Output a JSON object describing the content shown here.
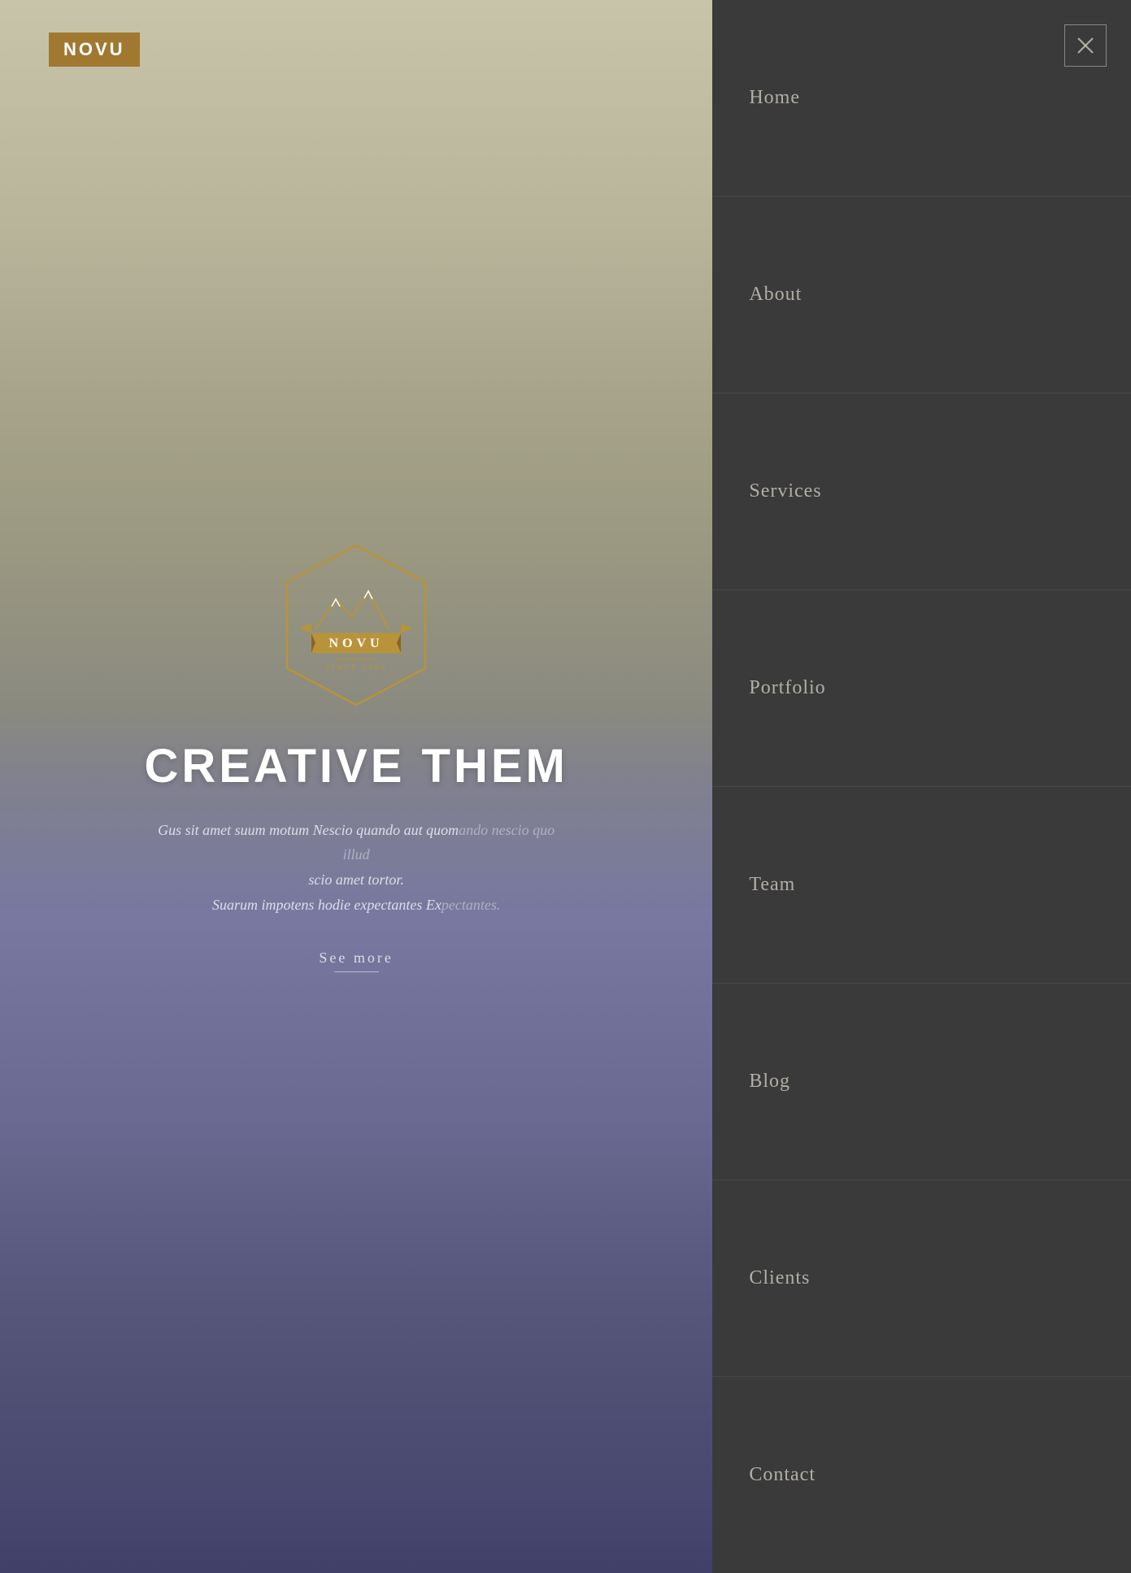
{
  "logo": {
    "text": "NOVU"
  },
  "badge": {
    "brand": "NOVU",
    "tagline": "SINCE 2009"
  },
  "hero": {
    "title": "CREATIVE THE",
    "subtitle_line1": "Gus sit amet suum motum Nescio quando aut quom",
    "subtitle_line1_faded": "ando nescio quo illud",
    "subtitle_line2": "scio amet tortor.",
    "subtitle_line3": "Suarum impotens hodie expectantes Ex",
    "subtitle_line3_faded": "pectantes.",
    "see_more": "See more"
  },
  "nav": {
    "close_label": "×",
    "items": [
      {
        "label": "Home"
      },
      {
        "label": "About"
      },
      {
        "label": "Services"
      },
      {
        "label": "Portfolio"
      },
      {
        "label": "Team"
      },
      {
        "label": "Blog"
      },
      {
        "label": "Clients"
      },
      {
        "label": "Contact"
      }
    ]
  },
  "colors": {
    "accent_gold": "#a07830",
    "nav_bg": "#3a3a3a",
    "nav_text": "rgba(200,195,185,0.85)"
  }
}
